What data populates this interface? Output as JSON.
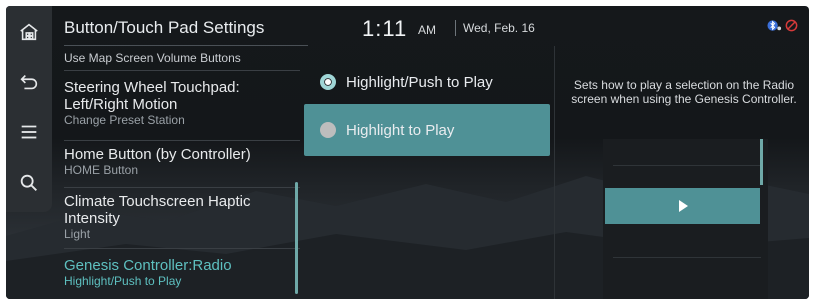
{
  "list": {
    "title": "Button/Touch Pad Settings",
    "items": [
      {
        "title": "Use Map Screen Volume Buttons",
        "sub": ""
      },
      {
        "title": "Steering Wheel Touchpad: Left/Right Motion",
        "sub": "Change Preset Station"
      },
      {
        "title": "Home Button (by Controller)",
        "sub": "HOME Button"
      },
      {
        "title": "Climate Touchscreen Haptic Intensity",
        "sub": "Light"
      },
      {
        "title": "Genesis Controller:Radio",
        "sub": "Highlight/Push to Play"
      }
    ]
  },
  "clock": {
    "time": "1:11",
    "ampm": "AM",
    "date": "Wed, Feb. 16"
  },
  "options": [
    {
      "label": "Highlight/Push to Play",
      "selected": true
    },
    {
      "label": "Highlight to Play",
      "selected": false
    }
  ],
  "help": {
    "text": "Sets how to play a selection on the Radio screen when using the Genesis Controller."
  },
  "rail": {
    "icons": [
      "home-icon",
      "back-icon",
      "menu-icon",
      "search-icon"
    ]
  },
  "status_icons": [
    "bluetooth-icon",
    "mute-icon"
  ],
  "colors": {
    "accent": "#4f9196",
    "accent_text": "#5ec0c0",
    "background": "#15181b"
  }
}
